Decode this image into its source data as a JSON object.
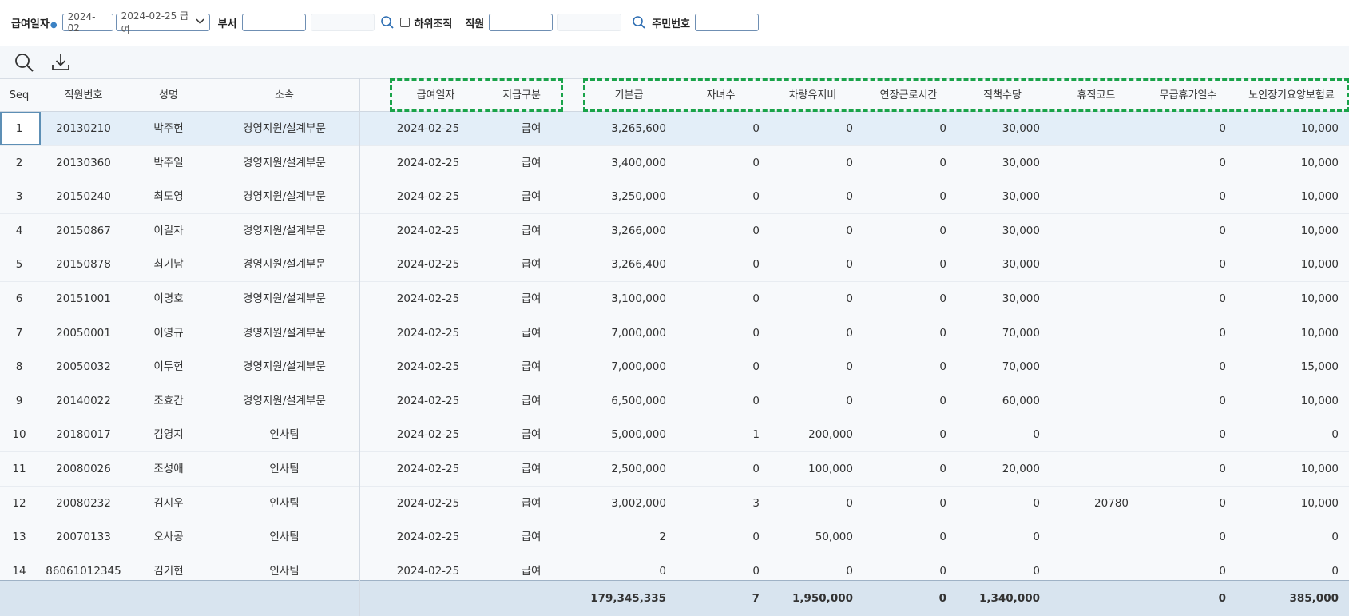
{
  "filters": {
    "pay_date_label": "급여일자",
    "pay_month": "2024-02",
    "pay_date_select": "2024-02-25 급여",
    "dept_label": "부서",
    "dept_value": "",
    "sub_org_label": "하위조직",
    "employee_label": "직원",
    "employee_value": "",
    "resident_no_label": "주민번호",
    "resident_no_value": ""
  },
  "toolbar": {
    "icons": [
      "search-icon",
      "download-icon"
    ]
  },
  "grid": {
    "columns": [
      "Seq",
      "직원번호",
      "성명",
      "소속",
      "급여일자",
      "지급구분",
      "기본급",
      "자녀수",
      "차량유지비",
      "연장근로시간",
      "직책수당",
      "휴직코드",
      "무급휴가일수",
      "노인장기요양보험료"
    ],
    "rows": [
      [
        "1",
        "20130210",
        "박주헌",
        "경영지원/설계부문",
        "2024-02-25",
        "급여",
        "3,265,600",
        "0",
        "0",
        "0",
        "30,000",
        "",
        "0",
        "10,000"
      ],
      [
        "2",
        "20130360",
        "박주일",
        "경영지원/설계부문",
        "2024-02-25",
        "급여",
        "3,400,000",
        "0",
        "0",
        "0",
        "30,000",
        "",
        "0",
        "10,000"
      ],
      [
        "3",
        "20150240",
        "최도영",
        "경영지원/설계부문",
        "2024-02-25",
        "급여",
        "3,250,000",
        "0",
        "0",
        "0",
        "30,000",
        "",
        "0",
        "10,000"
      ],
      [
        "4",
        "20150867",
        "이길자",
        "경영지원/설계부문",
        "2024-02-25",
        "급여",
        "3,266,000",
        "0",
        "0",
        "0",
        "30,000",
        "",
        "0",
        "10,000"
      ],
      [
        "5",
        "20150878",
        "최기남",
        "경영지원/설계부문",
        "2024-02-25",
        "급여",
        "3,266,400",
        "0",
        "0",
        "0",
        "30,000",
        "",
        "0",
        "10,000"
      ],
      [
        "6",
        "20151001",
        "이명호",
        "경영지원/설계부문",
        "2024-02-25",
        "급여",
        "3,100,000",
        "0",
        "0",
        "0",
        "30,000",
        "",
        "0",
        "10,000"
      ],
      [
        "7",
        "20050001",
        "이영규",
        "경영지원/설계부문",
        "2024-02-25",
        "급여",
        "7,000,000",
        "0",
        "0",
        "0",
        "70,000",
        "",
        "0",
        "10,000"
      ],
      [
        "8",
        "20050032",
        "이두헌",
        "경영지원/설계부문",
        "2024-02-25",
        "급여",
        "7,000,000",
        "0",
        "0",
        "0",
        "70,000",
        "",
        "0",
        "15,000"
      ],
      [
        "9",
        "20140022",
        "조효간",
        "경영지원/설계부문",
        "2024-02-25",
        "급여",
        "6,500,000",
        "0",
        "0",
        "0",
        "60,000",
        "",
        "0",
        "10,000"
      ],
      [
        "10",
        "20180017",
        "김영지",
        "인사팀",
        "2024-02-25",
        "급여",
        "5,000,000",
        "1",
        "200,000",
        "0",
        "0",
        "",
        "0",
        "0"
      ],
      [
        "11",
        "20080026",
        "조성애",
        "인사팀",
        "2024-02-25",
        "급여",
        "2,500,000",
        "0",
        "100,000",
        "0",
        "20,000",
        "",
        "0",
        "10,000"
      ],
      [
        "12",
        "20080232",
        "김시우",
        "인사팀",
        "2024-02-25",
        "급여",
        "3,002,000",
        "3",
        "0",
        "0",
        "0",
        "20780",
        "0",
        "10,000"
      ],
      [
        "13",
        "20070133",
        "오사공",
        "인사팀",
        "2024-02-25",
        "급여",
        "2",
        "0",
        "50,000",
        "0",
        "0",
        "",
        "0",
        "0"
      ],
      [
        "14",
        "86061012345",
        "김기현",
        "인사팀",
        "2024-02-25",
        "급여",
        "0",
        "0",
        "0",
        "0",
        "0",
        "",
        "0",
        "0"
      ]
    ],
    "totals": [
      "179,345,335",
      "7",
      "1,950,000",
      "0",
      "1,340,000",
      "0",
      "385,000"
    ]
  }
}
